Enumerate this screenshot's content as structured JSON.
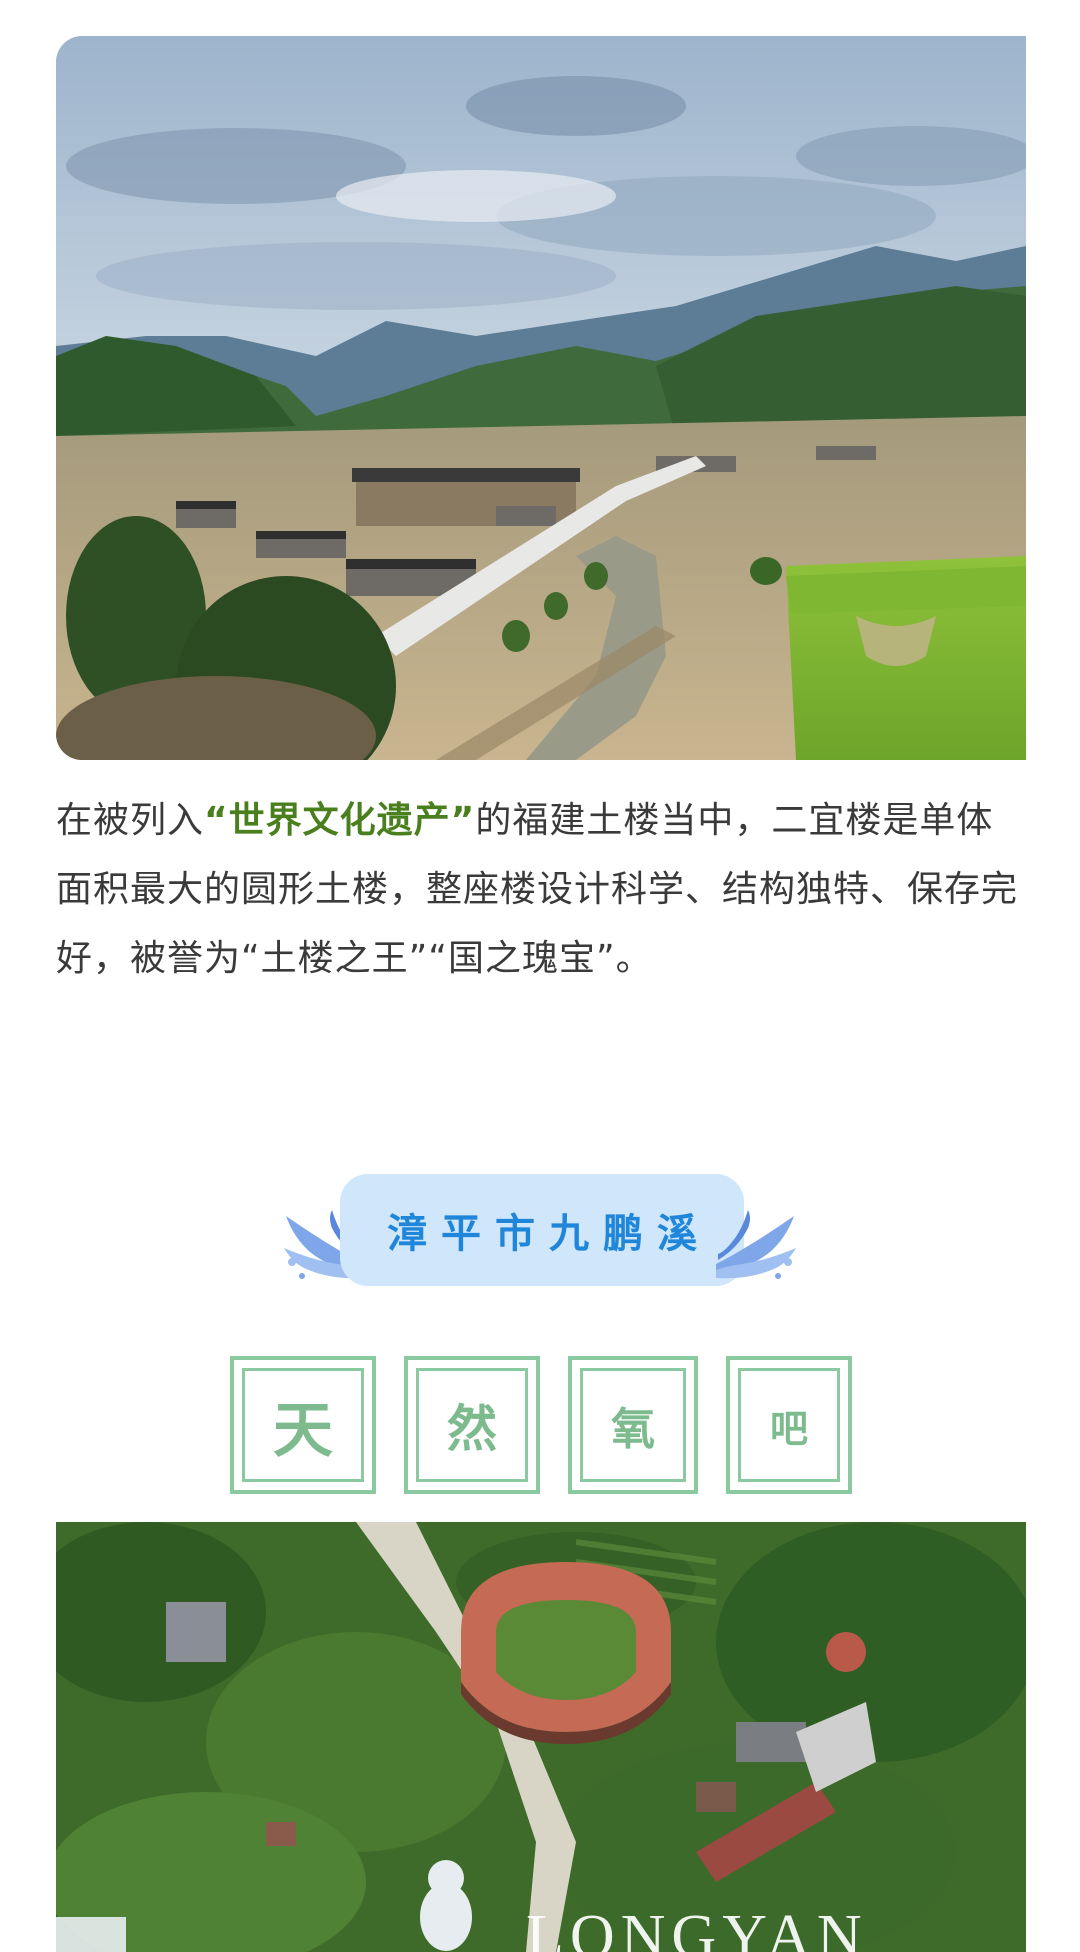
{
  "intro": {
    "prefix": "在被列入",
    "highlight": "“世界文化遗产”",
    "suffix": "的福建土楼当中，二宜楼是单体面积最大的圆形土楼，整座楼设计科学、结构独特、保存完好，被誉为“土楼之王”“国之瑰宝”。"
  },
  "section": {
    "title": "漳平市九鹏溪",
    "accent_color": "#1f86d9",
    "pill_color": "#cfe6fb"
  },
  "subtitle_chars": [
    "天",
    "然",
    "氧",
    "吧"
  ],
  "subtitle_color": "#8bc9a0",
  "bottom_photo": {
    "watermark": "LONGYAN"
  }
}
